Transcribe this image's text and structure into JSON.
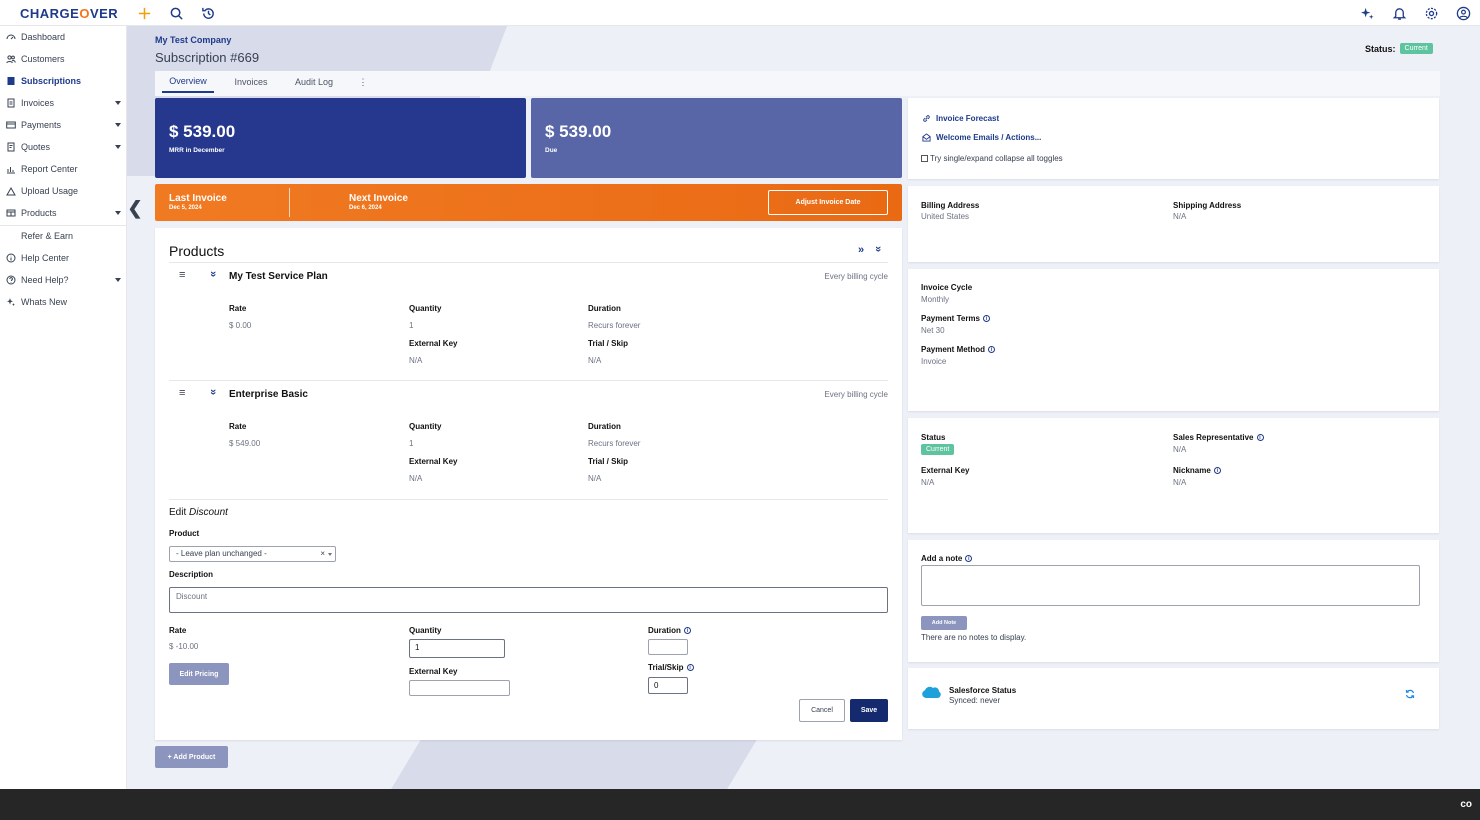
{
  "app": {
    "logo_left": "CHARGE",
    "logo_o": "O",
    "logo_right": "VER"
  },
  "sidebar": {
    "items": [
      {
        "label": "Dashboard",
        "icon": "dashboard-icon"
      },
      {
        "label": "Customers",
        "icon": "users-icon"
      },
      {
        "label": "Subscriptions",
        "icon": "subscriptions-icon"
      },
      {
        "label": "Invoices",
        "icon": "invoice-icon"
      },
      {
        "label": "Payments",
        "icon": "payments-icon"
      },
      {
        "label": "Quotes",
        "icon": "quotes-icon"
      },
      {
        "label": "Report Center",
        "icon": "chart-icon"
      },
      {
        "label": "Upload Usage",
        "icon": "upload-icon"
      },
      {
        "label": "Products",
        "icon": "products-icon"
      },
      {
        "label": "Refer & Earn",
        "icon": ""
      },
      {
        "label": "Help Center",
        "icon": "info-icon"
      },
      {
        "label": "Need Help?",
        "icon": "help-icon"
      },
      {
        "label": "Whats New",
        "icon": "sparkle-icon"
      }
    ]
  },
  "header": {
    "company": "My Test Company",
    "subscription": "Subscription #669",
    "status_label": "Status:",
    "status_value": "Current"
  },
  "tabs": [
    "Overview",
    "Invoices",
    "Audit Log",
    "⋮"
  ],
  "mrr": {
    "amount": "$ 539.00",
    "label": "MRR in December"
  },
  "due": {
    "amount": "$ 539.00",
    "label": "Due"
  },
  "invoice_bar": {
    "last_title": "Last Invoice",
    "last_date": "Dec 5, 2024",
    "next_title": "Next Invoice",
    "next_date": "Dec 6, 2024",
    "adjust_button": "Adjust Invoice Date"
  },
  "products": {
    "title": "Products",
    "items": [
      {
        "name": "My Test Service Plan",
        "cycle": "Every billing cycle",
        "rate_label": "Rate",
        "rate": "$ 0.00",
        "qty_label": "Quantity",
        "qty": "1",
        "duration_label": "Duration",
        "duration": "Recurs forever",
        "ext_label": "External Key",
        "ext": "N/A",
        "trial_label": "Trial / Skip",
        "trial": "N/A"
      },
      {
        "name": "Enterprise Basic",
        "cycle": "Every billing cycle",
        "rate_label": "Rate",
        "rate": "$ 549.00",
        "qty_label": "Quantity",
        "qty": "1",
        "duration_label": "Duration",
        "duration": "Recurs forever",
        "ext_label": "External Key",
        "ext": "N/A",
        "trial_label": "Trial / Skip",
        "trial": "N/A"
      }
    ],
    "edit": {
      "title_prefix": "Edit",
      "title_item": "Discount",
      "product_label": "Product",
      "product_value": "- Leave plan unchanged -",
      "description_label": "Description",
      "description_value": "Discount",
      "rate_label": "Rate",
      "rate_value": "$ -10.00",
      "quantity_label": "Quantity",
      "quantity_value": "1",
      "ext_key_label": "External Key",
      "ext_key_value": "",
      "duration_label": "Duration",
      "duration_value": "",
      "trial_label": "Trial/Skip",
      "trial_value": "0",
      "edit_pricing": "Edit Pricing",
      "cancel": "Cancel",
      "save": "Save"
    },
    "add_product": "+ Add Product"
  },
  "right": {
    "invoice_forecast": "Invoice Forecast",
    "welcome_emails": "Welcome Emails / Actions...",
    "toggle_text": "Try single/expand collapse all toggles",
    "billing_label": "Billing Address",
    "billing_value": "United States",
    "shipping_label": "Shipping Address",
    "shipping_value": "N/A",
    "cycle_label": "Invoice Cycle",
    "cycle_value": "Monthly",
    "terms_label": "Payment Terms",
    "terms_value": "Net 30",
    "method_label": "Payment Method",
    "method_value": "Invoice",
    "status_label": "Status",
    "status_value": "Current",
    "salesrep_label": "Sales Representative",
    "salesrep_value": "N/A",
    "extkey_label": "External Key",
    "extkey_value": "N/A",
    "nickname_label": "Nickname",
    "nickname_value": "N/A",
    "note_label": "Add a note",
    "add_note": "Add Note",
    "no_notes": "There are no notes to display.",
    "sf_title": "Salesforce Status",
    "sf_sub": "Synced: never"
  },
  "footer": {
    "mark": "co"
  },
  "colors": {
    "brand": "#1e3a8a",
    "accent": "#f97316",
    "mrr": "#25388e",
    "due": "#5865a7",
    "current": "#5ec4a0"
  }
}
